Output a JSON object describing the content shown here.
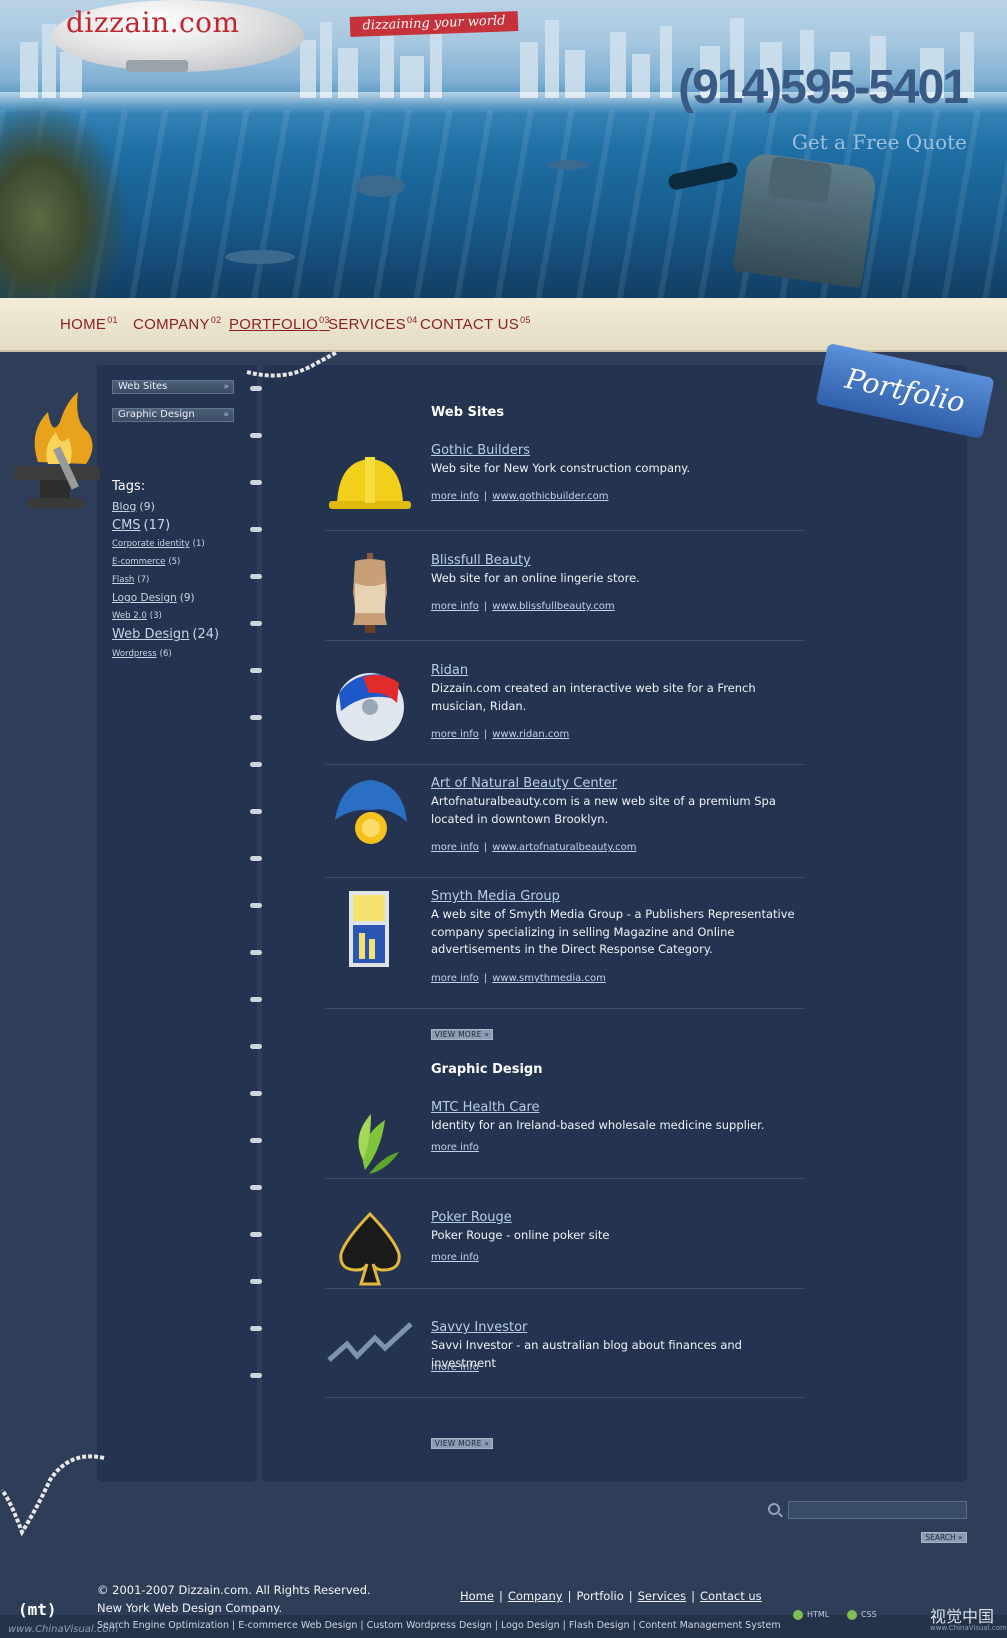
{
  "header": {
    "logo": "dizzain.com",
    "banner": "dizzaining your world",
    "phone": "(914)595-5401",
    "quote_link": "Get a Free Quote"
  },
  "nav": {
    "items": [
      {
        "label": "HOME",
        "num": "01"
      },
      {
        "label": "COMPANY",
        "num": "02"
      },
      {
        "label": "PORTFOLIO",
        "num": "03"
      },
      {
        "label": "SERVICES",
        "num": "04"
      },
      {
        "label": "CONTACT US",
        "num": "05"
      }
    ]
  },
  "portfolio_tag": "Portfolio",
  "sidebar": {
    "buttons": [
      "Web Sites",
      "Graphic Design"
    ],
    "tags_title": "Tags:",
    "tags": [
      {
        "name": "Blog",
        "count": "(9)"
      },
      {
        "name": "CMS",
        "count": "(17)"
      },
      {
        "name": "Corporate identity",
        "count": "(1)"
      },
      {
        "name": "E-commerce",
        "count": "(5)"
      },
      {
        "name": "Flash",
        "count": "(7)"
      },
      {
        "name": "Logo Design",
        "count": "(9)"
      },
      {
        "name": "Web 2.0",
        "count": "(3)"
      },
      {
        "name": "Web Design",
        "count": "(24)"
      },
      {
        "name": "Wordpress",
        "count": "(6)"
      }
    ]
  },
  "websites": {
    "title": "Web Sites",
    "items": [
      {
        "title": "Gothic Builders",
        "desc": "Web site for New York construction company.",
        "more": "more info",
        "url": "www.gothicbuilder.com",
        "icon": "hardhat-icon"
      },
      {
        "title": "Blissfull Beauty",
        "desc": "Web site for an online lingerie store.",
        "more": "more info",
        "url": "www.blissfullbeauty.com",
        "icon": "mannequin-icon"
      },
      {
        "title": "Ridan",
        "desc": "Dizzain.com created an interactive web site for a French musician, Ridan.",
        "more": "more info",
        "url": "www.ridan.com",
        "icon": "cd-icon"
      },
      {
        "title": "Art of Natural Beauty Center",
        "desc": "Artofnaturalbeauty.com is a new web site of a premium Spa located in downtown Brooklyn.",
        "more": "more info",
        "url": "www.artofnaturalbeauty.com",
        "icon": "spa-icon"
      },
      {
        "title": "Smyth Media Group",
        "desc": "A web site of Smyth Media Group - a Publishers Representative company specializing in selling Magazine and Online advertisements in the Direct Response Category.",
        "more": "more info",
        "url": "www.smythmedia.com",
        "icon": "smyth-logo-icon"
      }
    ],
    "view_more": "VIEW MORE »"
  },
  "graphic": {
    "title": "Graphic Design",
    "items": [
      {
        "title": "MTC Health Care",
        "desc": "Identity for an Ireland-based wholesale medicine supplier.",
        "more": "more info",
        "icon": "leaf-icon"
      },
      {
        "title": "Poker Rouge",
        "desc": "Poker Rouge - online poker site",
        "more": "more info",
        "icon": "spade-icon"
      },
      {
        "title": "Savvy Investor",
        "desc": "Savvi Investor - an australian blog about finances and investment",
        "more": "more info",
        "icon": "chart-arrow-icon"
      }
    ],
    "view_more": "VIEW MORE »"
  },
  "search": {
    "placeholder": "",
    "button": "SEARCH »"
  },
  "footer": {
    "copyright": "© 2001-2007 Dizzain.com. All Rights Reserved.",
    "company": "New York Web Design Company.",
    "links": [
      "Home",
      "Company",
      "Portfolio",
      "Services",
      "Contact us"
    ],
    "services": "Search Engine Optimization | E-commerce Web Design | Custom Wordpress Design | Logo Design | Flash Design | Content Management System",
    "badges": [
      "HTML",
      "CSS"
    ],
    "mt": "(mt)",
    "watermark_left": "www.ChinaVisual.com",
    "watermark_right": "视觉中国",
    "watermark_right_small": "www.ChinaVisual.com"
  }
}
